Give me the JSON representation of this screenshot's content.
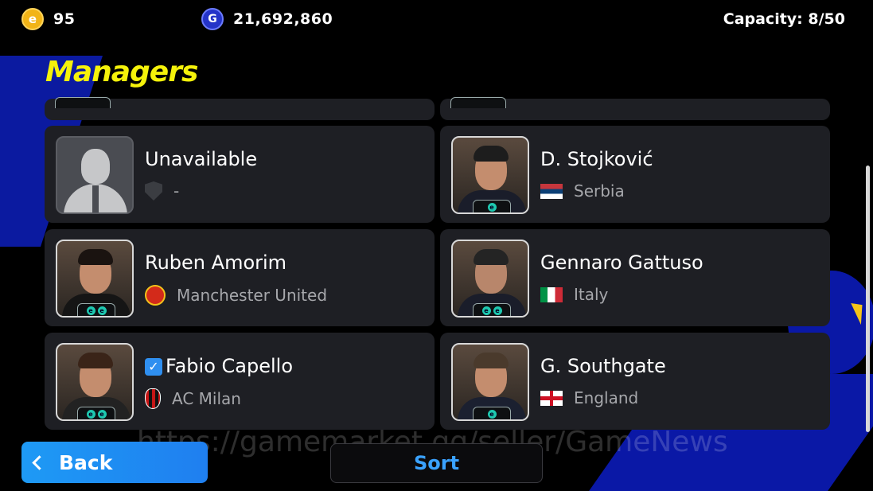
{
  "header": {
    "coins_value": "95",
    "gp_value": "21,692,860",
    "capacity_label": "Capacity: 8/50",
    "coin_symbol": "e",
    "gp_symbol": "G"
  },
  "page_title": "Managers",
  "managers": [
    {
      "name": "Unavailable",
      "club": "-",
      "club_icon": "shield-gray-icon",
      "verified": false
    },
    {
      "name": "D. Stojković",
      "club": "Serbia",
      "club_icon": "serbia-flag-icon",
      "verified": false
    },
    {
      "name": "Ruben Amorim",
      "club": "Manchester United",
      "club_icon": "manchester-united-crest-icon",
      "verified": false
    },
    {
      "name": "Gennaro Gattuso",
      "club": "Italy",
      "club_icon": "italy-flag-icon",
      "verified": false
    },
    {
      "name": "Fabio Capello",
      "club": "AC Milan",
      "club_icon": "ac-milan-crest-icon",
      "verified": true
    },
    {
      "name": "G. Southgate",
      "club": "England",
      "club_icon": "england-flag-icon",
      "verified": false
    }
  ],
  "footer": {
    "back_label": "Back",
    "sort_label": "Sort"
  },
  "watermark": "https://gamemarket.gg/seller/GameNews",
  "colors": {
    "title": "#f5f20a",
    "back_button": "#1e8ff2",
    "sort_text": "#3aa2ff",
    "card_bg": "#1e1f24"
  }
}
